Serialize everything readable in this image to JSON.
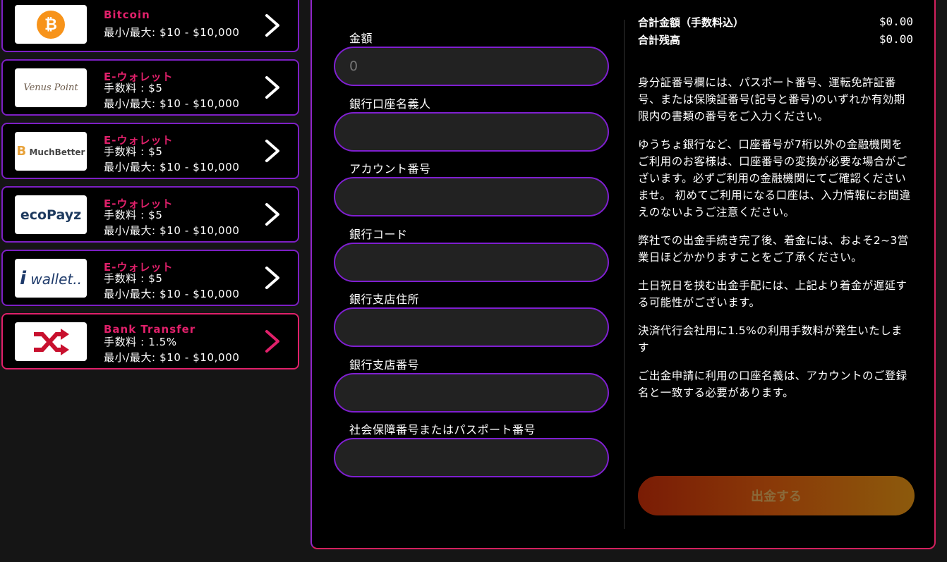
{
  "methods": [
    {
      "name": "Bitcoin",
      "fee": "",
      "limits": "最小/最大: $10 - $10,000",
      "logo": "bitcoin-logo",
      "logo_text": "₿"
    },
    {
      "name": "E-ウォレット",
      "fee": "手数料 : $5",
      "limits": "最小/最大: $10 - $10,000",
      "logo": "venus-point-logo",
      "logo_text": "Venus Point"
    },
    {
      "name": "E-ウォレット",
      "fee": "手数料 : $5",
      "limits": "最小/最大: $10 - $10,000",
      "logo": "muchbetter-logo",
      "logo_text": "MuchBetter"
    },
    {
      "name": "E-ウォレット",
      "fee": "手数料 : $5",
      "limits": "最小/最大: $10 - $10,000",
      "logo": "ecopayz-logo",
      "logo_text": "ecoPayz"
    },
    {
      "name": "E-ウォレット",
      "fee": "手数料 : $5",
      "limits": "最小/最大: $10 - $10,000",
      "logo": "iwallet-logo",
      "logo_text": "wallet.."
    },
    {
      "name": "Bank Transfer",
      "fee": "手数料 : 1.5%",
      "limits": "最小/最大: $10 - $10,000",
      "logo": "bank-transfer-logo",
      "logo_text": ""
    }
  ],
  "form": {
    "amount_label": "金額",
    "amount_placeholder": "0",
    "holder_label": "銀行口座名義人",
    "account_label": "アカウント番号",
    "bank_code_label": "銀行コード",
    "branch_address_label": "銀行支店住所",
    "branch_number_label": "銀行支店番号",
    "ssn_label": "社会保障番号またはパスポート番号"
  },
  "summary": {
    "total_label": "合計金額（手数料込）",
    "total_value": "$0.00",
    "balance_label": "合計残高",
    "balance_value": "$0.00"
  },
  "notes": [
    "身分証番号欄には、パスポート番号、運転免許証番号、または保険証番号(記号と番号)のいずれか有効期限内の書類の番号をご入力ください。",
    "ゆうちょ銀行など、口座番号が7桁以外の金融機関をご利用のお客様は、口座番号の変換が必要な場合がございます。必ずご利用の金融機関にてご確認くださいませ。 初めてご利用になる口座は、入力情報にお間違えのないようご注意ください。",
    "弊社での出金手続き完了後、着金には、およそ2~3営業日ほどかかりますことをご了承ください。",
    "土日祝日を挟む出金手配には、上記より着金が遅延する可能性がございます。",
    "決済代行会社用に1.5%の利用手数料が発生いたします",
    "ご出金申請に利用の口座名義は、アカウントのご登録名と一致する必要があります。"
  ],
  "submit_label": "出金する",
  "colors": {
    "accent": "#e0206a",
    "border": "#7d1fc4",
    "button_start": "#7a1c05",
    "button_end": "#8c5a0c"
  }
}
